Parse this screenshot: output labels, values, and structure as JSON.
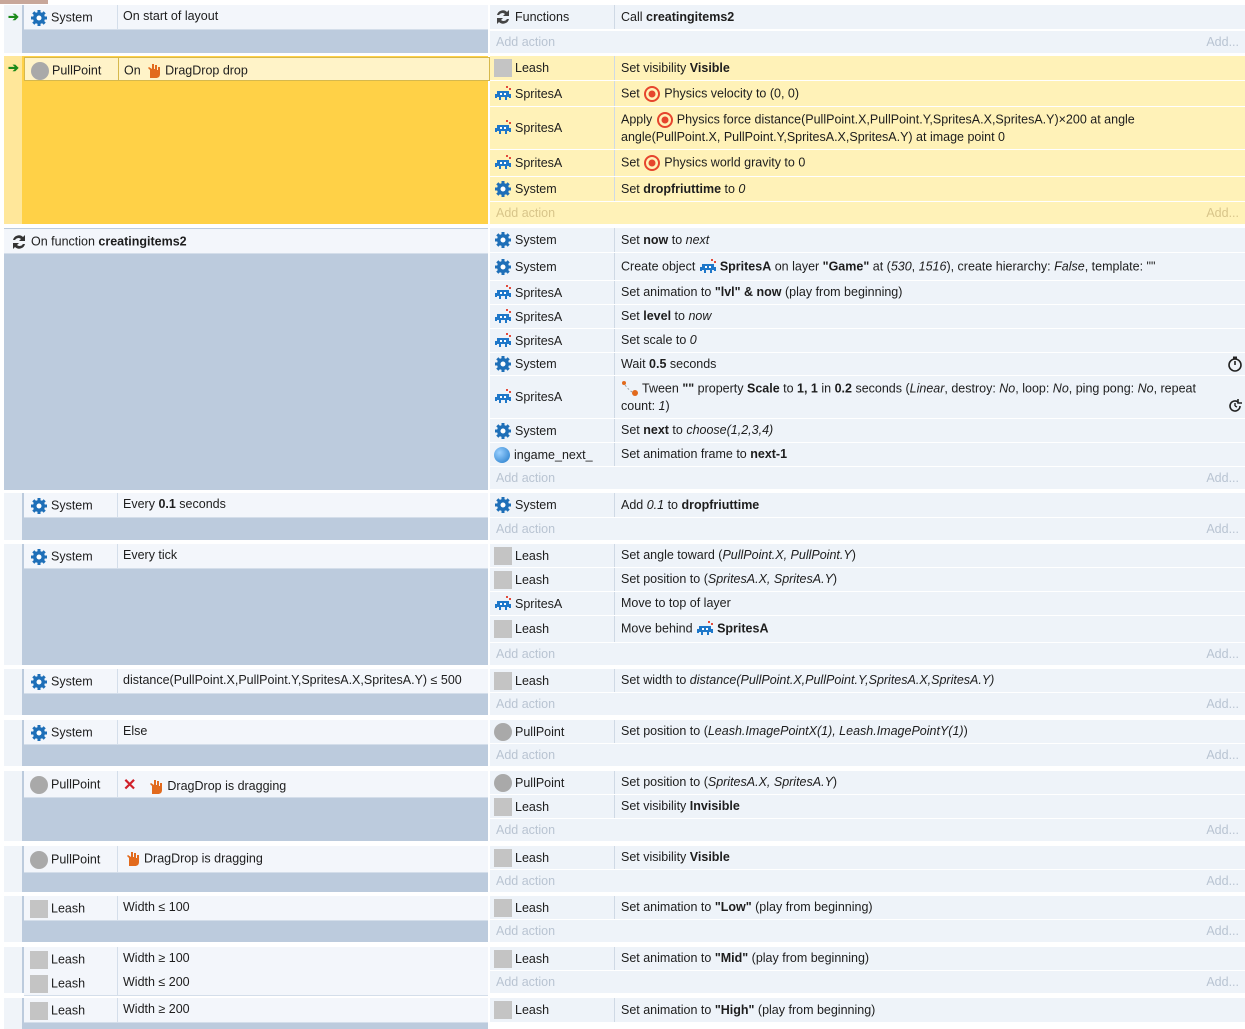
{
  "colors": {
    "accent_selected": "#ffd147",
    "condition_area": "#bccbdd",
    "row_bg": "#eef3f9"
  },
  "add_action_label": "Add action",
  "add_label": "Add...",
  "events": {
    "e1": {
      "obj": "System",
      "cond": "On start of layout",
      "a1": {
        "obj": "Functions",
        "pre": "Call ",
        "b1": "creatingitems2"
      }
    },
    "e2": {
      "obj": "PullPoint",
      "pre": "On ",
      "beh": "DragDrop drop",
      "a1": {
        "obj": "Leash",
        "pre": "Set visibility ",
        "b1": "Visible"
      },
      "a2": {
        "obj": "SpritesA",
        "pre": "Set ",
        "post": "Physics velocity to (0, 0)"
      },
      "a3": {
        "obj": "SpritesA",
        "pre": "Apply ",
        "post": "Physics force distance(PullPoint.X,PullPoint.Y,SpritesA.X,SpritesA.Y)×200 at angle angle(PullPoint.X, PullPoint.Y,SpritesA.X,SpritesA.Y) at image point 0"
      },
      "a4": {
        "obj": "SpritesA",
        "pre": "Set ",
        "post": "Physics world gravity to 0"
      },
      "a5": {
        "obj": "System",
        "pre": "Set ",
        "b1": "dropfriuttime",
        "mid": " to ",
        "i1": "0"
      }
    },
    "e3": {
      "pre": "On function ",
      "b1": "creatingitems2",
      "a1": {
        "obj": "System",
        "pre": "Set ",
        "b1": "now",
        "mid": " to ",
        "i1": "next"
      },
      "a2": {
        "obj": "System",
        "pre": "Create object ",
        "b1": "SpritesA",
        "mid": " on layer ",
        "b2": "\"Game\"",
        "mid2": " at (",
        "i1": "530",
        "mid3": ", ",
        "i2": "1516",
        "mid4": "), create hierarchy: ",
        "i3": "False",
        "mid5": ", template: \"\""
      },
      "a3": {
        "obj": "SpritesA",
        "pre": "Set animation to ",
        "b1": "\"lvl\" & now",
        "post": " (play from beginning)"
      },
      "a4": {
        "obj": "SpritesA",
        "pre": "Set ",
        "b1": "level",
        "mid": " to ",
        "i1": "now"
      },
      "a5": {
        "obj": "SpritesA",
        "pre": "Set scale to ",
        "i1": "0"
      },
      "a6": {
        "obj": "System",
        "pre": "Wait ",
        "b1": "0.5",
        "post": " seconds"
      },
      "a7": {
        "obj": "SpritesA",
        "pre": "Tween ",
        "b1": "\"\"",
        "mid": " property ",
        "b2": "Scale",
        "mid2": " to ",
        "b3": "1, 1",
        "mid3": " in ",
        "b4": "0.2",
        "mid4": " seconds (",
        "i1": "Linear",
        "mid5": ", destroy: ",
        "i2": "No",
        "mid6": ", loop: ",
        "i3": "No",
        "mid7": ", ping pong: ",
        "i4": "No",
        "mid8": ", repeat count: ",
        "i5": "1",
        "post": ")"
      },
      "a8": {
        "obj": "System",
        "pre": "Set ",
        "b1": "next",
        "mid": " to ",
        "i1": "choose(1,2,3,4)"
      },
      "a9": {
        "obj": "ingame_next_",
        "pre": "Set animation frame to ",
        "b1": "next-1"
      }
    },
    "e4": {
      "obj": "System",
      "pre": "Every ",
      "b1": "0.1",
      "post": " seconds",
      "a1": {
        "obj": "System",
        "pre": "Add ",
        "i1": "0.1",
        "mid": " to ",
        "b1": "dropfriuttime"
      }
    },
    "e5": {
      "obj": "System",
      "cond": "Every tick",
      "a1": {
        "obj": "Leash",
        "pre": "Set angle toward (",
        "i1": "PullPoint.X, PullPoint.Y",
        "post": ")"
      },
      "a2": {
        "obj": "Leash",
        "pre": "Set position to (",
        "i1": "SpritesA.X, SpritesA.Y",
        "post": ")"
      },
      "a3": {
        "obj": "SpritesA",
        "pre": "Move to top of layer"
      },
      "a4": {
        "obj": "Leash",
        "pre": "Move behind ",
        "b1": "SpritesA"
      }
    },
    "e6": {
      "obj": "System",
      "cond": "distance(PullPoint.X,PullPoint.Y,SpritesA.X,SpritesA.Y) ≤ 500",
      "a1": {
        "obj": "Leash",
        "pre": "Set width to ",
        "i1": "distance(PullPoint.X,PullPoint.Y,SpritesA.X,SpritesA.Y)"
      }
    },
    "e7": {
      "obj": "System",
      "cond": "Else",
      "a1": {
        "obj": "PullPoint",
        "pre": "Set position to (",
        "i1": "Leash.ImagePointX(1), Leash.ImagePointY(1)",
        "post": ")"
      }
    },
    "e8": {
      "obj": "PullPoint",
      "beh": "DragDrop is dragging",
      "a1": {
        "obj": "PullPoint",
        "pre": "Set position to (",
        "i1": "SpritesA.X, SpritesA.Y",
        "post": ")"
      },
      "a2": {
        "obj": "Leash",
        "pre": "Set visibility ",
        "b1": "Invisible"
      }
    },
    "e9": {
      "obj": "PullPoint",
      "beh": "DragDrop is dragging",
      "a1": {
        "obj": "Leash",
        "pre": "Set visibility ",
        "b1": "Visible"
      }
    },
    "e10": {
      "obj": "Leash",
      "cond": "Width ≤ 100",
      "a1": {
        "obj": "Leash",
        "pre": "Set animation to ",
        "b1": "\"Low\"",
        "post": " (play from beginning)"
      }
    },
    "e11": {
      "obj": "Leash",
      "cond": "Width ≥ 100",
      "obj2": "Leash",
      "cond2": "Width ≤ 200",
      "a1": {
        "obj": "Leash",
        "pre": "Set animation to ",
        "b1": "\"Mid\"",
        "post": " (play from beginning)"
      }
    },
    "e12": {
      "obj": "Leash",
      "cond": "Width ≥ 200",
      "a1": {
        "obj": "Leash",
        "pre": "Set animation to ",
        "b1": "\"High\"",
        "post": " (play from beginning)"
      }
    }
  }
}
